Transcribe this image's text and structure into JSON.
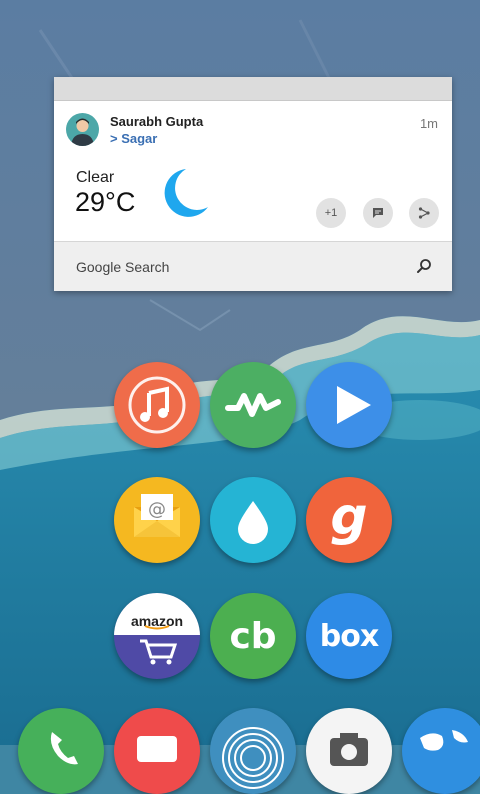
{
  "card": {
    "user_name": "Saurabh Gupta",
    "location": "> Sagar",
    "time_ago": "1m",
    "weather_condition": "Clear",
    "temperature": "29°C",
    "plus_one": "+1",
    "search_label": "Google Search"
  },
  "apps": [
    {
      "name": "music",
      "icon": "music-note-icon",
      "color": "#ef6c4a"
    },
    {
      "name": "activity",
      "icon": "pulse-wave-icon",
      "color": "#4caf63"
    },
    {
      "name": "play",
      "icon": "play-icon",
      "color": "#3d8fe8"
    },
    {
      "name": "email",
      "icon": "envelope-icon",
      "color": "#f5b820"
    },
    {
      "name": "drop",
      "icon": "water-drop-icon",
      "color": "#25b4d4"
    },
    {
      "name": "gaana",
      "icon": "g-letter-icon",
      "color": "#f0643c",
      "text": "g"
    },
    {
      "name": "amazon",
      "icon": "shopping-cart-icon",
      "color": "#4f4aa6",
      "text": "amazon"
    },
    {
      "name": "cashback",
      "icon": "cb-icon",
      "color": "#4caf50",
      "text": "cb"
    },
    {
      "name": "box",
      "icon": "box-icon",
      "color": "#2e8be6",
      "text": "box"
    },
    {
      "name": "phone",
      "icon": "phone-icon",
      "color": "#46b05a"
    },
    {
      "name": "messages",
      "icon": "message-icon",
      "color": "#ef4b4b"
    },
    {
      "name": "fingerprint",
      "icon": "fingerprint-icon",
      "color": "#3f8fbf"
    },
    {
      "name": "camera",
      "icon": "camera-icon",
      "color": "#f4f4f4"
    },
    {
      "name": "browser",
      "icon": "globe-icon",
      "color": "#2f8fe0"
    }
  ]
}
